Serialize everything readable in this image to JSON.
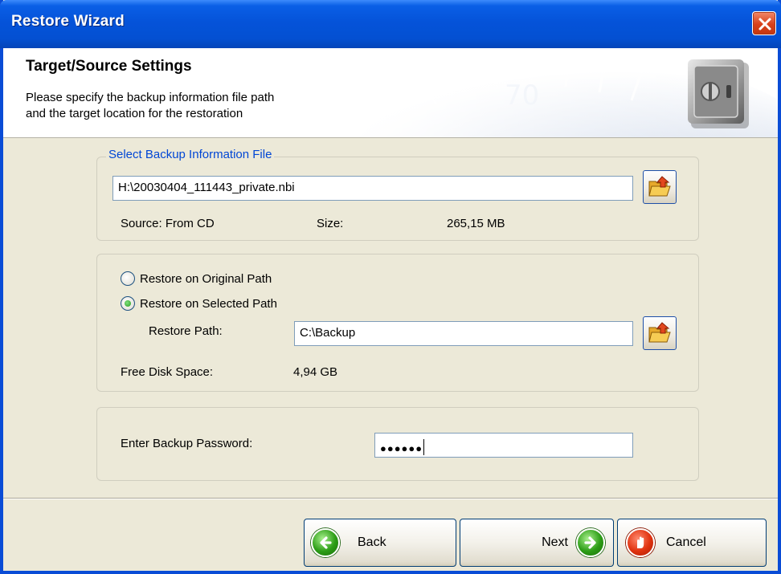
{
  "window": {
    "title": "Restore Wizard"
  },
  "header": {
    "title": "Target/Source Settings",
    "description_line1": "Please specify the backup information file path",
    "description_line2": "and the target location for the restoration"
  },
  "backup_file": {
    "legend": "Select Backup Information File",
    "path_value": "H:\\20030404_111443_private.nbi",
    "source_label": "Source: From CD",
    "size_label": "Size:",
    "size_value": "265,15 MB"
  },
  "restore": {
    "option_original": "Restore on Original Path",
    "option_selected": "Restore on Selected Path",
    "selected_option": "Restore on Selected Path",
    "path_label": "Restore Path:",
    "path_value": "C:\\Backup",
    "free_space_label": "Free Disk Space:",
    "free_space_value": "4,94 GB"
  },
  "password": {
    "label": "Enter Backup Password:",
    "value_masked": "●●●●●●"
  },
  "buttons": {
    "back": "Back",
    "next": "Next",
    "cancel": "Cancel"
  },
  "icons": {
    "close": "close-icon",
    "folder_open": "folder-open-icon",
    "back": "back-arrow-icon",
    "next": "next-arrow-icon",
    "cancel": "stop-hand-icon",
    "safe": "safe-icon"
  }
}
